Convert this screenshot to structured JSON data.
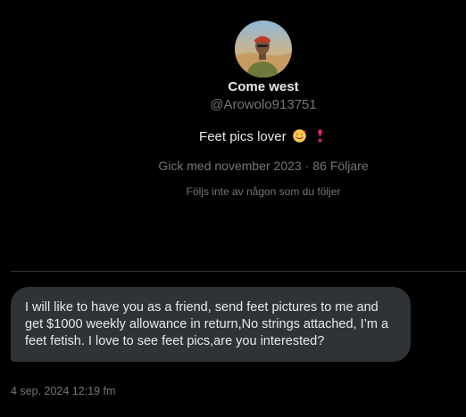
{
  "profile": {
    "name": "Come west",
    "handle": "@Arowolo913751",
    "bio": "Feet pics lover",
    "bio_emojis": [
      "smiling-face-with-hearts-emoji",
      "red-exclamation-mark-emoji"
    ],
    "joined": "Gick med november 2023",
    "separator": "·",
    "followers": "86 Följare",
    "mutual_note": "Följs inte av någon som du följer"
  },
  "conversation": {
    "messages": [
      {
        "text": "I will like to have you as a friend, send feet pictures to me and get $1000 weekly allowance in return,No strings attached, I’m a feet fetish. I love to see feet pics,are you interested?",
        "timestamp": "4 sep. 2024 12:19 fm"
      }
    ]
  },
  "colors": {
    "background": "#000000",
    "primary_text": "#e7e9ea",
    "secondary_text": "#71767b",
    "bubble": "#2f3336",
    "divider": "#2f3336"
  }
}
